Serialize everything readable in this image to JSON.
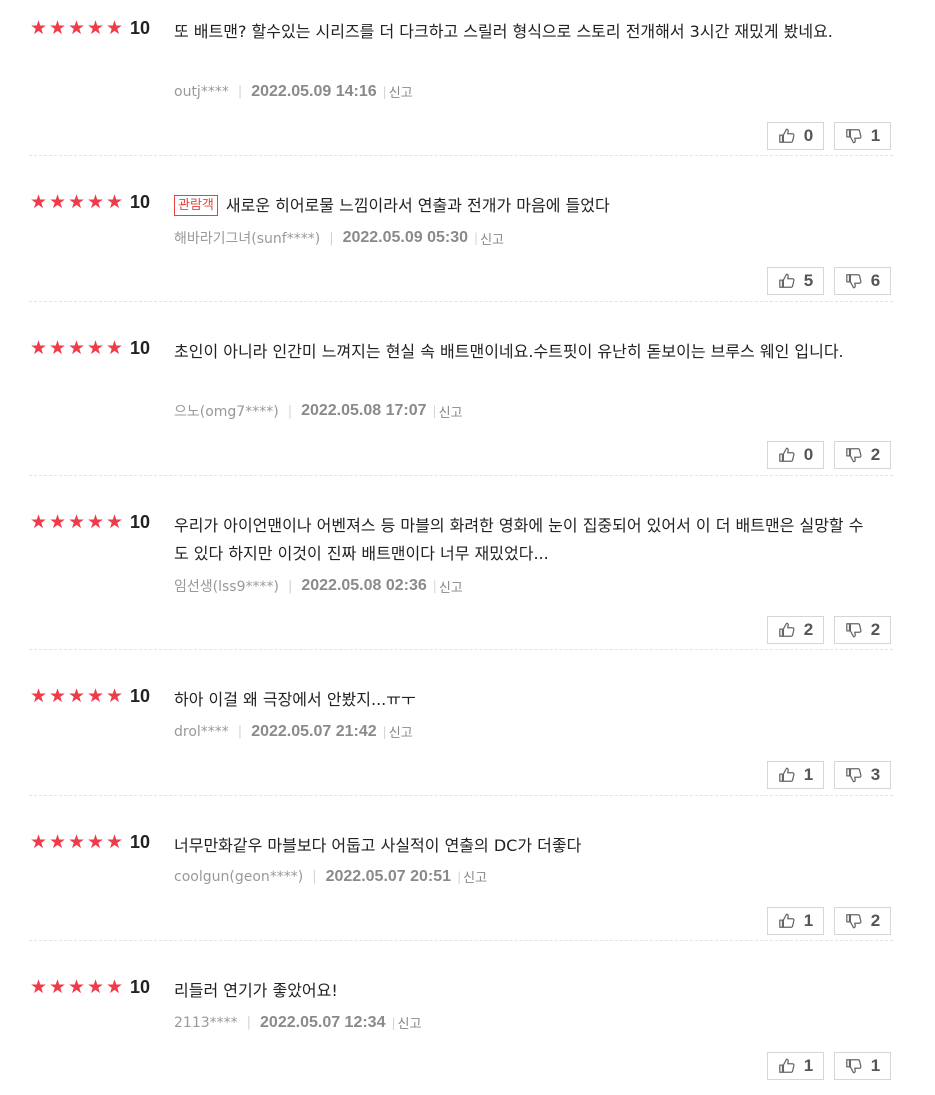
{
  "reviews": [
    {
      "score": "10",
      "badge": "",
      "text": "또 배트맨? 할수있는 시리즈를 더 다크하고 스릴러 형식으로 스토리 전개해서 3시간 재밌게 봤네요.",
      "author": "outj****",
      "date": "2022.05.09 14:16",
      "report": "신고",
      "likes": "0",
      "dislikes": "1"
    },
    {
      "score": "10",
      "badge": "관람객",
      "text": "새로운 히어로물 느낌이라서 연출과 전개가 마음에 들었다",
      "author": "해바라기그녀(sunf****)",
      "date": "2022.05.09 05:30",
      "report": "신고",
      "likes": "5",
      "dislikes": "6"
    },
    {
      "score": "10",
      "badge": "",
      "text": "초인이 아니라 인간미 느껴지는 현실 속 배트맨이네요.수트핏이 유난히 돋보이는 브루스 웨인 입니다.",
      "author": "으노(omg7****)",
      "date": "2022.05.08 17:07",
      "report": "신고",
      "likes": "0",
      "dislikes": "2"
    },
    {
      "score": "10",
      "badge": "",
      "text": "우리가 아이언맨이나 어벤져스 등 마블의 화려한 영화에 눈이 집중되어 있어서 이 더 배트맨은 실망할 수도 있다 하지만 이것이 진짜 배트맨이다 너무 재밌었다...",
      "author": "임선생(lss9****)",
      "date": "2022.05.08 02:36",
      "report": "신고",
      "likes": "2",
      "dislikes": "2"
    },
    {
      "score": "10",
      "badge": "",
      "text": "하아 이걸 왜 극장에서 안봤지...ㅠㅜ",
      "author": "drol****",
      "date": "2022.05.07 21:42",
      "report": "신고",
      "likes": "1",
      "dislikes": "3"
    },
    {
      "score": "10",
      "badge": "",
      "text": "너무만화같우 마블보다 어둡고 사실적이 연출의 DC가 더좋다",
      "author": "coolgun(geon****)",
      "date": "2022.05.07 20:51",
      "report": "신고",
      "likes": "1",
      "dislikes": "2"
    },
    {
      "score": "10",
      "badge": "",
      "text": "리들러 연기가 좋았어요!",
      "author": "2113****",
      "date": "2022.05.07 12:34",
      "report": "신고",
      "likes": "1",
      "dislikes": "1"
    }
  ],
  "icons": {
    "star": "star-icon",
    "like": "thumbs-up-icon",
    "dislike": "thumbs-down-icon"
  },
  "colors": {
    "star": "#ef3b4a",
    "badge": "#e8423a"
  }
}
